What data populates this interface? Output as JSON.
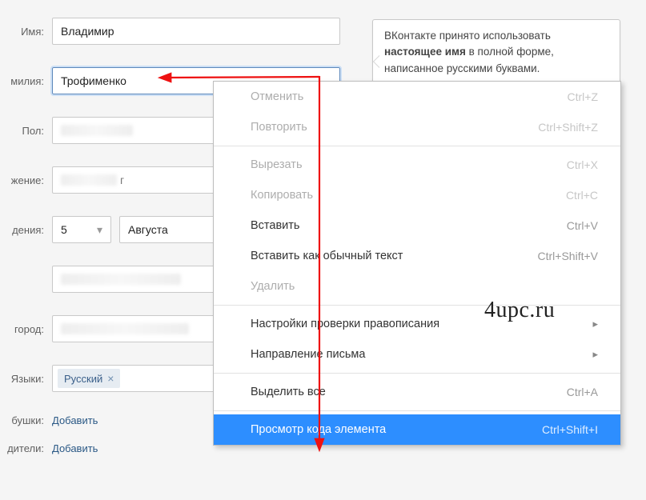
{
  "form": {
    "name_label": "Имя:",
    "name_value": "Владимир",
    "surname_label": "милия:",
    "surname_value": "Трофименко",
    "gender_label": "Пол:",
    "gender_value": "",
    "marital_label": "жение:",
    "marital_suffix": "г",
    "birth_label": "дения:",
    "birth_day": "5",
    "birth_month": "Августа",
    "city_label": "город:",
    "langs_label": "Языки:",
    "lang_tag": "Русский",
    "grandma_label": "бушки:",
    "grandma_link": "Добавить",
    "parents_label": "дители:",
    "parents_link": "Добавить"
  },
  "tooltip": {
    "line1": "ВКонтакте принято использовать ",
    "bold": "настоящее имя",
    "line2": " в полной форме, написанное русскими буквами."
  },
  "menu": {
    "undo": "Отменить",
    "undo_sc": "Ctrl+Z",
    "redo": "Повторить",
    "redo_sc": "Ctrl+Shift+Z",
    "cut": "Вырезать",
    "cut_sc": "Ctrl+X",
    "copy": "Копировать",
    "copy_sc": "Ctrl+C",
    "paste": "Вставить",
    "paste_sc": "Ctrl+V",
    "paste_plain": "Вставить как обычный текст",
    "paste_plain_sc": "Ctrl+Shift+V",
    "delete": "Удалить",
    "spell": "Настройки проверки правописания",
    "direction": "Направление письма",
    "select_all": "Выделить все",
    "select_all_sc": "Ctrl+A",
    "inspect": "Просмотр кода элемента",
    "inspect_sc": "Ctrl+Shift+I"
  },
  "watermark": "4upc.ru"
}
